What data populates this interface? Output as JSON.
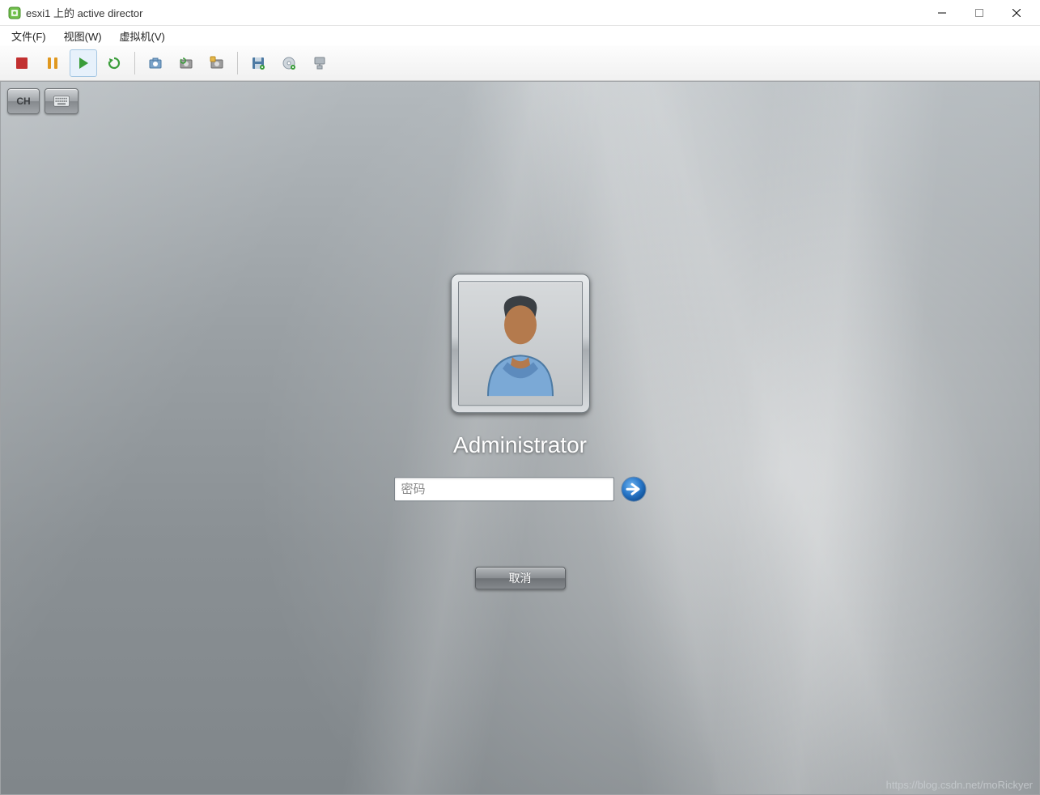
{
  "window": {
    "title": "esxi1 上的 active director"
  },
  "menu": {
    "file": "文件(F)",
    "view": "视图(W)",
    "vm": "虚拟机(V)"
  },
  "guest_buttons": {
    "ime": "CH"
  },
  "login": {
    "username": "Administrator",
    "password_placeholder": "密码",
    "cancel_label": "取消"
  },
  "watermark": "https://blog.csdn.net/moRickyer"
}
